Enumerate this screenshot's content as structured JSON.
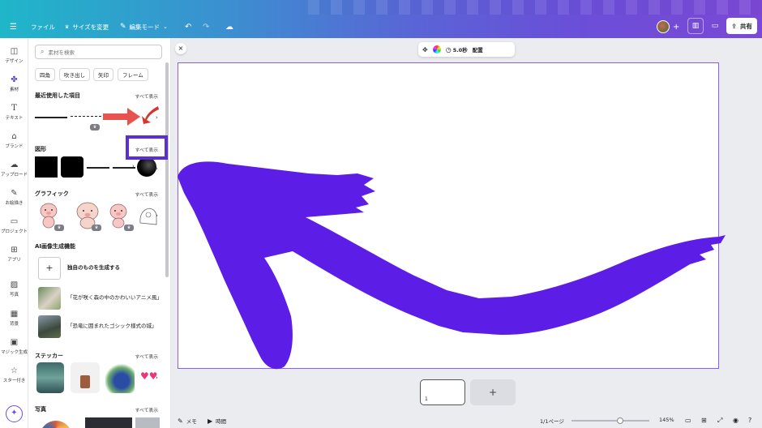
{
  "topbar": {
    "menu_icon": "hamburger-icon",
    "file_label": "ファイル",
    "resize_label": "サイズを変更",
    "edit_mode_label": "編集モード",
    "share_label": "共有"
  },
  "rail": {
    "items": [
      {
        "label": "デザイン",
        "icon": "layout-icon"
      },
      {
        "label": "素材",
        "icon": "elements-icon"
      },
      {
        "label": "テキスト",
        "icon": "text-icon"
      },
      {
        "label": "ブランド",
        "icon": "brand-icon"
      },
      {
        "label": "アップロード",
        "icon": "upload-icon"
      },
      {
        "label": "お絵描き",
        "icon": "draw-icon"
      },
      {
        "label": "プロジェクト",
        "icon": "folder-icon"
      },
      {
        "label": "アプリ",
        "icon": "apps-icon"
      },
      {
        "label": "写真",
        "icon": "photo-icon"
      },
      {
        "label": "背景",
        "icon": "background-icon"
      },
      {
        "label": "マジック生成",
        "icon": "magic-icon"
      },
      {
        "label": "スター付き",
        "icon": "star-icon"
      }
    ]
  },
  "panel": {
    "search_placeholder": "素材を検索",
    "chips": [
      "四角",
      "吹き出し",
      "矢印",
      "フレーム"
    ],
    "sections": {
      "recent": "最近使用した項目",
      "shapes": "図形",
      "graphics": "グラフィック",
      "ai": "AI画像生成機能",
      "stickers": "ステッカー",
      "photos": "写真"
    },
    "see_all": "すべて表示",
    "ai_items": [
      "独自のものを生成する",
      "「花が咲く森の中のかわいいアニメ風」",
      "「恐竜に囲まれたゴシック様式の城」"
    ]
  },
  "floating_toolbar": {
    "duration": "5.0秒",
    "arrange": "配置"
  },
  "pages": {
    "page_number": "1"
  },
  "bottombar": {
    "notes": "メモ",
    "timer": "時間",
    "page_count": "1/1ページ",
    "zoom": "145%",
    "zoom_level": 0.62
  },
  "colors": {
    "accent": "#5b2fd6",
    "arrow": "#5c1ee6",
    "red_arrow": "#e8544d"
  }
}
